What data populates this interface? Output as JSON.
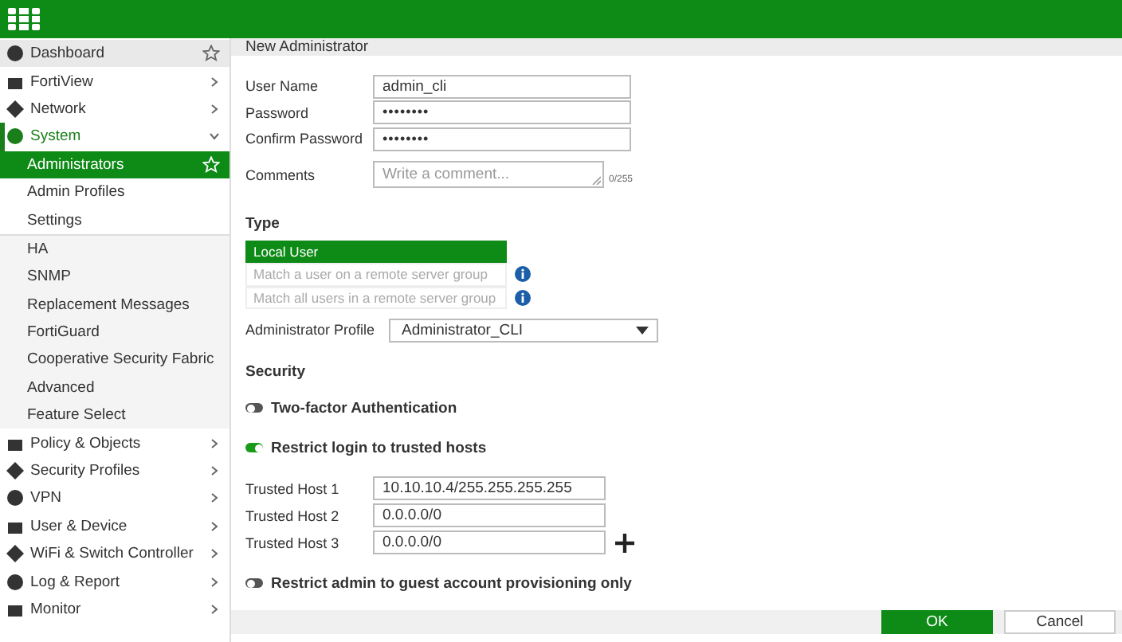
{
  "sidebar": {
    "items": [
      {
        "label": "Dashboard",
        "kind": "link",
        "starred": true,
        "selected": false
      },
      {
        "label": "FortiView",
        "kind": "menu",
        "expanded": false,
        "selected": false
      },
      {
        "label": "Network",
        "kind": "menu",
        "expanded": false,
        "selected": false
      },
      {
        "label": "System",
        "kind": "menu",
        "expanded": true,
        "selected": false,
        "children": [
          {
            "label": "Administrators",
            "kind": "primary",
            "selected": true,
            "starred": true
          },
          {
            "label": "Admin Profiles",
            "kind": "primary",
            "selected": false,
            "starred": false
          },
          {
            "label": "Settings",
            "kind": "primary",
            "selected": false,
            "starred": false
          },
          {
            "label": "HA",
            "kind": "secondary",
            "selected": false,
            "starred": false
          },
          {
            "label": "SNMP",
            "kind": "secondary",
            "selected": false,
            "starred": false
          },
          {
            "label": "Replacement Messages",
            "kind": "secondary",
            "selected": false,
            "starred": false
          },
          {
            "label": "FortiGuard",
            "kind": "secondary",
            "selected": false,
            "starred": false
          },
          {
            "label": "Cooperative Security Fabric",
            "kind": "secondary",
            "selected": false,
            "starred": false
          },
          {
            "label": "Advanced",
            "kind": "secondary",
            "selected": false,
            "starred": false
          },
          {
            "label": "Feature Select",
            "kind": "secondary",
            "selected": false,
            "starred": false
          }
        ]
      },
      {
        "label": "Policy & Objects",
        "kind": "menu",
        "expanded": false,
        "selected": false
      },
      {
        "label": "Security Profiles",
        "kind": "menu",
        "expanded": false,
        "selected": false
      },
      {
        "label": "VPN",
        "kind": "menu",
        "expanded": false,
        "selected": false
      },
      {
        "label": "User & Device",
        "kind": "menu",
        "expanded": false,
        "selected": false
      },
      {
        "label": "WiFi & Switch Controller",
        "kind": "menu",
        "expanded": false,
        "selected": false
      },
      {
        "label": "Log & Report",
        "kind": "menu",
        "expanded": false,
        "selected": false
      },
      {
        "label": "Monitor",
        "kind": "menu",
        "expanded": false,
        "selected": false
      }
    ]
  },
  "page": {
    "title": "New Administrator",
    "fields": [
      {
        "label": "User Name",
        "kind": "text",
        "value": "admin_cli"
      },
      {
        "label": "Password",
        "kind": "password",
        "value": "••••••••"
      },
      {
        "label": "Confirm Password",
        "kind": "password",
        "value": "••••••••"
      },
      {
        "label": "Comments",
        "kind": "textarea",
        "placeholder": "Write a comment...",
        "counter": "0/255"
      }
    ],
    "type": {
      "heading": "Type",
      "options": [
        {
          "label": "Local User",
          "selected": true,
          "info": false
        },
        {
          "label": "Match a user on a remote server group",
          "selected": false,
          "info": true
        },
        {
          "label": "Match all users in a remote server group",
          "selected": false,
          "info": true
        }
      ]
    },
    "profile": {
      "label": "Administrator Profile",
      "value": "Administrator_CLI"
    },
    "security": {
      "heading": "Security",
      "toggles": [
        {
          "label": "Two-factor Authentication",
          "on": false
        },
        {
          "label": "Restrict login to trusted hosts",
          "on": true
        }
      ],
      "trusted_hosts": [
        {
          "label": "Trusted Host 1",
          "value": "10.10.10.4/255.255.255.255"
        },
        {
          "label": "Trusted Host 2",
          "value": "0.0.0.0/0"
        },
        {
          "label": "Trusted Host 3",
          "value": "0.0.0.0/0"
        }
      ],
      "guest_toggle": {
        "label": "Restrict admin to guest account provisioning only",
        "on": false
      }
    },
    "buttons": [
      {
        "label": "OK",
        "kind": "primary"
      },
      {
        "label": "Cancel",
        "kind": "secondary"
      }
    ]
  }
}
